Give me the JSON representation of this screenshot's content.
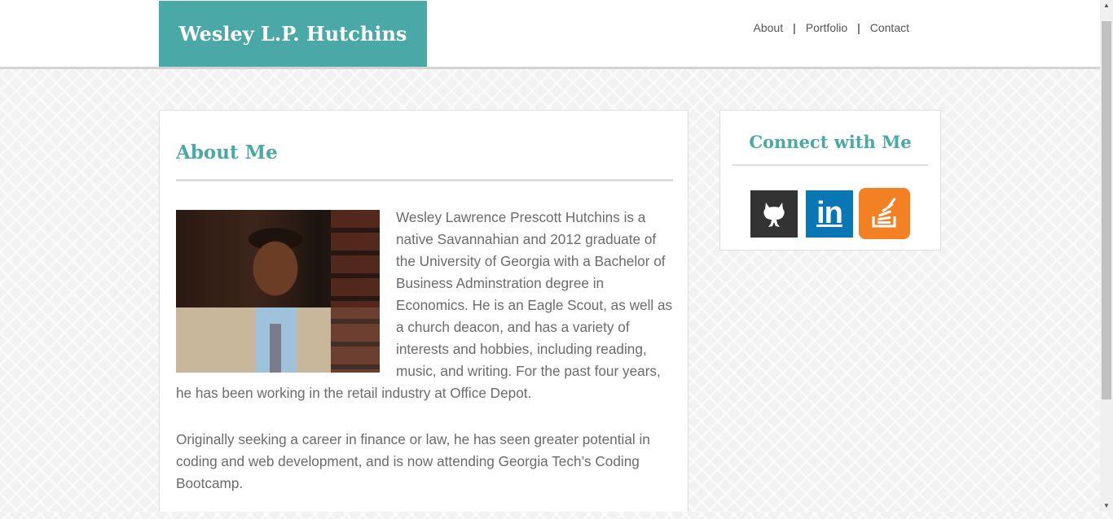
{
  "header": {
    "brand": "Wesley L.P. Hutchins",
    "nav": [
      "About",
      "Portfolio",
      "Contact"
    ],
    "separator": "|"
  },
  "main": {
    "title": "About Me",
    "paragraphs": [
      "Wesley Lawrence Prescott Hutchins is a native Savannahian and 2012 graduate of the University of Georgia with a Bachelor of Business Adminstration degree in Economics. He is an Eagle Scout, as well as a church deacon, and has a variety of interests and hobbies, including reading, music, and writing. For the past four years, he has been working in the retail industry at Office Depot.",
      "Originally seeking a career in finance or law, he has seen greater potential in coding and web development, and is now attending Georgia Tech’s Coding Bootcamp."
    ]
  },
  "sidebar": {
    "title": "Connect with Me",
    "links": [
      {
        "icon": "github-icon",
        "color": "#333333"
      },
      {
        "icon": "linkedin-icon",
        "color": "#0a77b5",
        "text": "in"
      },
      {
        "icon": "stackoverflow-icon",
        "color": "#f48024"
      }
    ]
  },
  "colors": {
    "accent": "#4aa8a6",
    "text": "#6b6b6b"
  }
}
